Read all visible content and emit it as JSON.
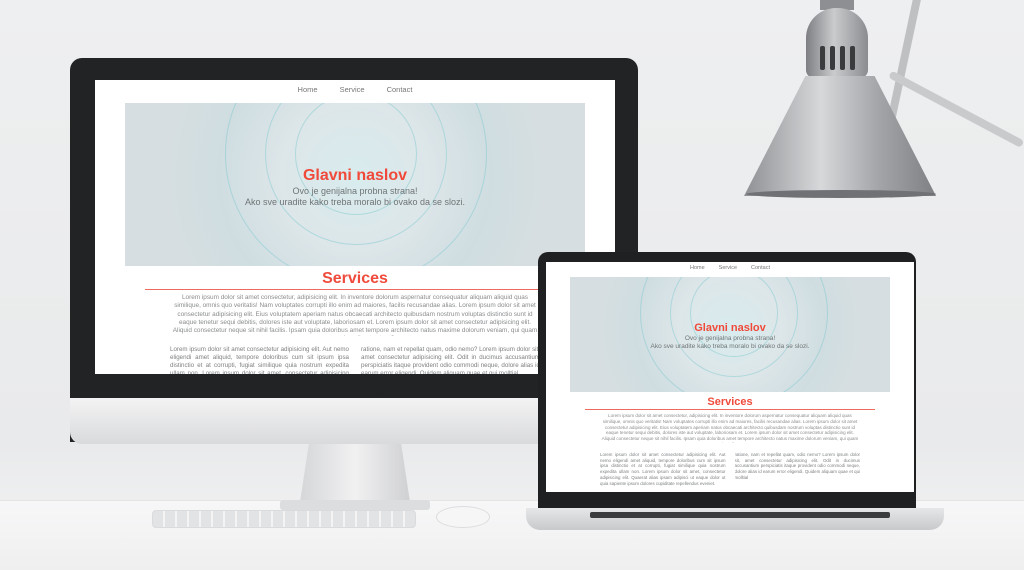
{
  "site": {
    "nav": [
      "Home",
      "Service",
      "Contact"
    ],
    "hero_title": "Glavni naslov",
    "hero_line1": "Ovo je genijalna probna strana!",
    "hero_line2": "Ako sve uradite kako treba moralo bi ovako da se slozi.",
    "services_title": "Services",
    "services_text": "Lorem ipsum dolor sit amet consectetur, adipisicing elit. In inventore dolorum aspernatur consequatur aliquam aliquid quas similique, omnis quo veritatis! Nam voluptates corrupti illo enim ad maiores, facilis recusandae alias. Lorem ipsum dolor sit amet consectetur adipisicing elit. Eius voluptatem aperiam natus obcaecati architecto quibusdam nostrum voluptas distinctio sunt id eaque tenetur sequi debitis, dolores iste aut voluptate, laboriosam et. Lorem ipsum dolor sit amet consectetur adipisicing elit. Aliquid consectetur neque sit nihil facilis. Ipsam quia doloribus amet tempore architecto natus maxime dolorum veniam, qui quam assumenda nulla ut autem?",
    "col1_text": "Lorem ipsum dolor sit amet consectetur adipisicing elit. Aut nemo eligendi amet aliquid, tempore doloribus cum sit ipsum ipsa distinctio et at corrupti, fugiat similique quia nostrum expedita ullam non. Lorem ipsum dolor sit amet, consectetur adipisicing elit. Quaerat alias ipsam adipisci ut eaque dolor ut quia sapiente ipsum dolores cupiditate repellendus eveniet.",
    "col2_text": "ratione, nam et repellat quam, odio nemo? Lorem ipsum dolor sit, amet consectetur adipisicing elit. Odit in ducimus accusantium perspiciatis itaque provident odio commodi neque, dolore alias id earum error eligendi. Quidem aliquam quae et qui molltial"
  }
}
